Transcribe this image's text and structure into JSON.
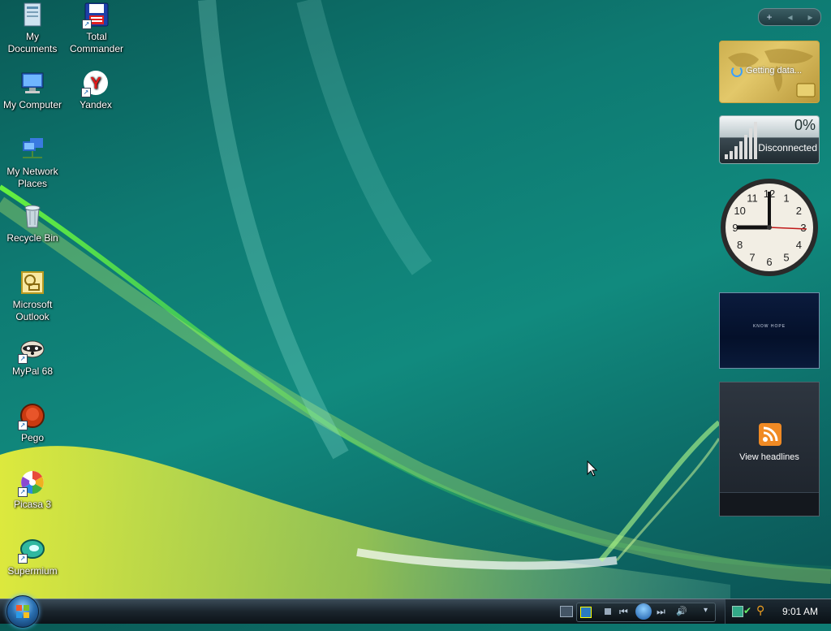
{
  "desktop_icons": [
    {
      "name": "my-documents",
      "label": "My Documents"
    },
    {
      "name": "total-commander",
      "label": "Total Commander"
    },
    {
      "name": "my-computer",
      "label": "My Computer"
    },
    {
      "name": "yandex",
      "label": "Yandex"
    },
    {
      "name": "my-network-places",
      "label": "My Network Places"
    },
    {
      "name": "recycle-bin",
      "label": "Recycle Bin"
    },
    {
      "name": "microsoft-outlook",
      "label": "Microsoft Outlook"
    },
    {
      "name": "mypal-68",
      "label": "MyPal 68"
    },
    {
      "name": "pego",
      "label": "Pego"
    },
    {
      "name": "picasa-3",
      "label": "Picasa 3"
    },
    {
      "name": "supermium",
      "label": "Supermium"
    }
  ],
  "gadgets": {
    "map_status": "Getting data...",
    "network": {
      "percent": "0%",
      "status": "Disconnected"
    },
    "clock_numbers": [
      "12",
      "1",
      "2",
      "3",
      "4",
      "5",
      "6",
      "7",
      "8",
      "9",
      "10",
      "11"
    ],
    "slideshow_caption": "KNOW HOPE",
    "feed_label": "View headlines"
  },
  "taskbar": {
    "time": "9:01 AM"
  },
  "colors": {
    "accent": "#2a6fb0",
    "feed_icon": "#f08a24"
  }
}
